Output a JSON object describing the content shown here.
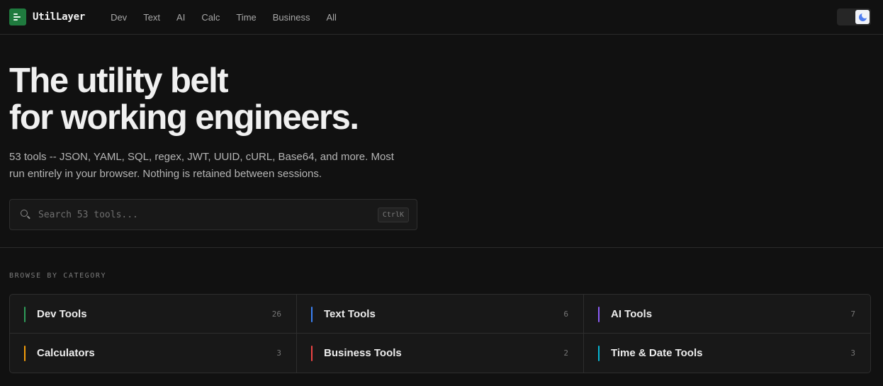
{
  "brand": {
    "name": "UtilLayer"
  },
  "nav": [
    "Dev",
    "Text",
    "AI",
    "Calc",
    "Time",
    "Business",
    "All"
  ],
  "theme_toggle": {
    "icon": "moon-icon",
    "accent": "#4f7df0"
  },
  "hero": {
    "headline_line1": "The utility belt",
    "headline_line2": "for working engineers.",
    "description_line1": "53 tools -- JSON, YAML, SQL, regex, JWT, UUID, cURL, Base64, and more. Most",
    "description_line2": "run entirely in your browser. Nothing is retained between sessions."
  },
  "search": {
    "placeholder": "Search 53 tools...",
    "shortcut": "CtrlK",
    "icon": "search-icon"
  },
  "categories_section": {
    "label": "BROWSE BY CATEGORY",
    "items": [
      {
        "name": "Dev Tools",
        "count": "26",
        "color": "#2f9e5a"
      },
      {
        "name": "Text Tools",
        "count": "6",
        "color": "#3b82f6"
      },
      {
        "name": "AI Tools",
        "count": "7",
        "color": "#8b5cf6"
      },
      {
        "name": "Calculators",
        "count": "3",
        "color": "#f59e0b"
      },
      {
        "name": "Business Tools",
        "count": "2",
        "color": "#ef4444"
      },
      {
        "name": "Time & Date Tools",
        "count": "3",
        "color": "#06b6d4"
      }
    ]
  },
  "brand_color": "#1f7a3e"
}
